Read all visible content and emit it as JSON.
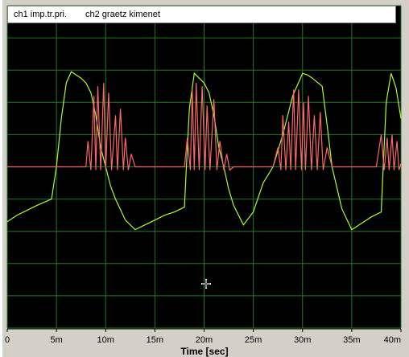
{
  "legend": {
    "ch1": "ch1 imp.tr.pri.",
    "ch2": "ch2 graetz kimenet"
  },
  "colors": {
    "plot_bg": "#000000",
    "grid": "#1f7a1f",
    "ch1": "#aaff22",
    "ch2": "#ff6666"
  },
  "chart_data": {
    "type": "line",
    "xlabel": "Time [sec]",
    "ylabel": "",
    "title": "",
    "xlim": [
      0,
      40
    ],
    "ylim": [
      -5,
      5
    ],
    "x_ticks": [
      "0",
      "5m",
      "10m",
      "15m",
      "20m",
      "25m",
      "30m",
      "35m",
      "40m"
    ],
    "grid": true,
    "legend_position": "top",
    "series": [
      {
        "name": "ch1 imp.tr.pri.",
        "x": [
          0,
          1,
          2,
          3,
          4.5,
          5,
          5.5,
          6,
          6.5,
          7,
          7.5,
          8,
          8.5,
          9,
          9.5,
          10,
          10.5,
          11,
          12,
          13,
          14,
          15,
          16,
          17,
          18,
          18.2,
          18.5,
          19,
          19.5,
          20,
          20.5,
          21,
          21.5,
          22,
          22.5,
          23,
          24,
          25,
          26,
          27,
          28,
          29,
          30,
          30.5,
          31,
          32,
          32.5,
          33,
          34,
          35,
          36,
          37,
          38,
          38.2,
          38.5,
          39,
          39.5,
          40
        ],
        "values": [
          -1.7,
          -1.5,
          -1.35,
          -1.2,
          -1.0,
          0.0,
          1.5,
          2.6,
          2.95,
          2.85,
          2.75,
          2.6,
          2.3,
          1.6,
          0.6,
          0.0,
          -0.6,
          -1.0,
          -1.65,
          -1.95,
          -1.8,
          -1.65,
          -1.5,
          -1.4,
          -1.25,
          0.0,
          1.8,
          2.9,
          2.75,
          2.6,
          2.3,
          1.6,
          0.6,
          0.0,
          -0.7,
          -1.2,
          -1.8,
          -1.4,
          -0.5,
          0.0,
          1.0,
          2.2,
          2.9,
          2.85,
          2.75,
          2.5,
          1.3,
          0.0,
          -1.3,
          -1.95,
          -1.75,
          -1.55,
          -1.4,
          0.0,
          2.0,
          2.9,
          2.45,
          1.5
        ]
      },
      {
        "name": "ch2 graetz kimenet",
        "x": [
          0,
          8,
          8.2,
          8.5,
          8.8,
          9,
          9.2,
          9.5,
          9.8,
          10.0,
          10.3,
          10.6,
          11.0,
          11.2,
          11.5,
          11.8,
          12.0,
          12.3,
          12.6,
          13,
          18,
          18.3,
          18.6,
          18.8,
          19.0,
          19.2,
          19.5,
          19.8,
          20.1,
          20.3,
          20.6,
          21.0,
          21.3,
          21.6,
          22.0,
          22.3,
          22.6,
          23,
          27,
          27.5,
          27.8,
          28.0,
          28.3,
          28.6,
          28.8,
          29.1,
          29.3,
          29.6,
          29.9,
          30.1,
          30.3,
          30.6,
          30.9,
          31.2,
          31.5,
          31.8,
          32.1,
          32.5,
          33,
          37.5,
          38,
          38.3,
          38.6,
          38.8,
          39.1,
          39.3,
          39.6,
          39.8,
          40
        ],
        "values": [
          0.0,
          0.0,
          0.8,
          -0.1,
          2.2,
          -0.1,
          2.5,
          -0.1,
          2.6,
          -0.1,
          2.3,
          -0.1,
          1.6,
          -0.1,
          1.8,
          -0.1,
          0.9,
          -0.1,
          0.4,
          0.0,
          0.0,
          0.9,
          -0.1,
          2.4,
          -0.1,
          2.6,
          -0.1,
          2.5,
          -0.1,
          1.9,
          -0.1,
          2.1,
          -0.1,
          0.8,
          -0.1,
          0.4,
          -0.1,
          0.0,
          0.0,
          0.6,
          -0.1,
          1.6,
          -0.1,
          1.4,
          -0.1,
          2.4,
          -0.1,
          2.4,
          -0.1,
          2.0,
          -0.1,
          2.2,
          -0.1,
          1.6,
          -0.1,
          1.7,
          -0.1,
          0.6,
          0.0,
          0.0,
          1.0,
          -0.1,
          0.9,
          -0.1,
          1.0,
          -0.1,
          0.8,
          -0.1,
          0.1
        ]
      }
    ]
  }
}
